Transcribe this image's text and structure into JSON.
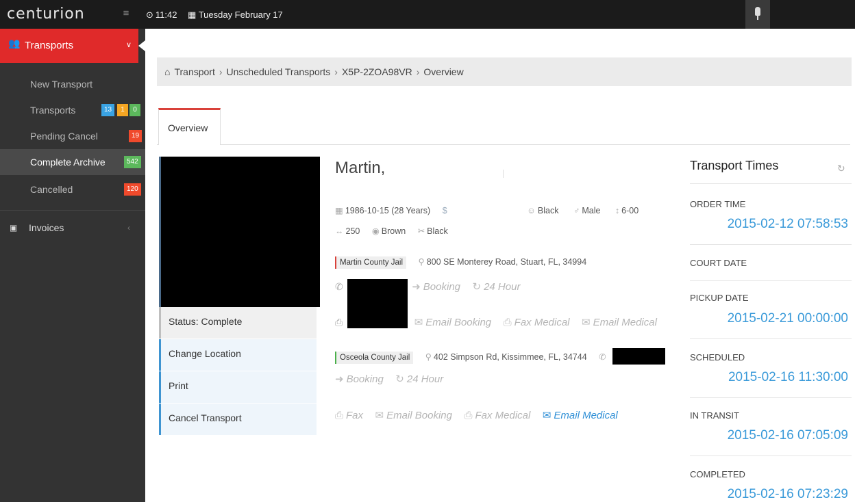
{
  "topbar": {
    "logo": "centurion",
    "time": "11:42",
    "date": "Tuesday February 17"
  },
  "sidebar": {
    "section_label": "Transports",
    "items": [
      {
        "label": "New Transport"
      },
      {
        "label": "Transports",
        "badges": [
          "13",
          "1",
          "0"
        ]
      },
      {
        "label": "Pending Cancel",
        "badges": [
          "19"
        ]
      },
      {
        "label": "Complete Archive",
        "badges": [
          "542"
        ],
        "active": true
      },
      {
        "label": "Cancelled",
        "badges": [
          "120"
        ]
      }
    ],
    "invoices_label": "Invoices"
  },
  "breadcrumb": {
    "items": [
      "Transport",
      "Unscheduled Transports",
      "X5P-2ZOA98VR",
      "Overview"
    ],
    "separator": "›"
  },
  "tabs": [
    {
      "label": "Overview",
      "active": true
    }
  ],
  "actions": {
    "status": "Status: Complete",
    "change_location": "Change Location",
    "print": "Print",
    "cancel_transport": "Cancel Transport"
  },
  "person": {
    "name": "Martin,",
    "dob": "1986-10-15 (28 Years)",
    "currency_symbol": "$",
    "race": "Black",
    "sex": "Male",
    "height": "6-00",
    "weight": "250",
    "eyes": "Brown",
    "hair": "Black"
  },
  "origin": {
    "name": "Martin County Jail",
    "address": "800 SE Monterey Road, Stuart, FL, 34994",
    "booking": "Booking",
    "hours": "24 Hour",
    "email_booking": "Email Booking",
    "fax_medical": "Fax Medical",
    "email_medical": "Email Medical"
  },
  "destination": {
    "name": "Osceola County Jail",
    "address": "402 Simpson Rd, Kissimmee, FL, 34744",
    "booking": "Booking",
    "hours": "24 Hour",
    "fax": "Fax",
    "email_booking": "Email Booking",
    "fax_medical": "Fax Medical",
    "email_medical": "Email Medical"
  },
  "transport_times": {
    "title": "Transport Times",
    "order_time_label": "ORDER TIME",
    "order_time": "2015-02-12 07:58:53",
    "court_date_label": "COURT DATE",
    "pickup_date_label": "PICKUP DATE",
    "pickup_date": "2015-02-21 00:00:00",
    "scheduled_label": "SCHEDULED",
    "scheduled": "2015-02-16 11:30:00",
    "in_transit_label": "IN TRANSIT",
    "in_transit": "2015-02-16 07:05:09",
    "completed_label": "COMPLETED",
    "completed": "2015-02-16 07:23:29"
  },
  "colors": {
    "accent_red": "#e02a2a",
    "link_blue": "#3a9ad9",
    "sidebar_bg": "#333333",
    "topbar_bg": "#1b1b1b"
  }
}
